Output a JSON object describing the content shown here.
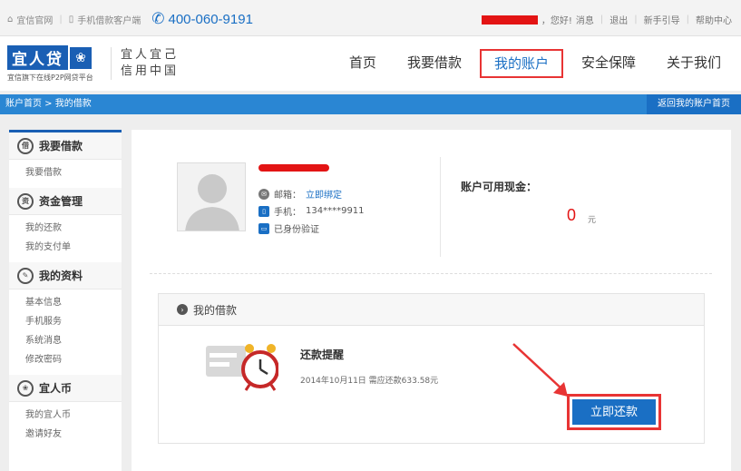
{
  "topbar": {
    "official_site": "宜信官网",
    "mobile_client": "手机借款客户端",
    "hotline": "400-060-9191",
    "greeting": "，您好!",
    "messages": "消息",
    "logout": "退出",
    "newbie_guide": "新手引导",
    "help_center": "帮助中心"
  },
  "logo": {
    "name": "宜人贷",
    "subtitle": "宜信旗下在线P2P网贷平台",
    "slogan_line1": "宜人宜己",
    "slogan_line2": "信用中国"
  },
  "nav": {
    "items": [
      "首页",
      "我要借款",
      "我的账户",
      "安全保障",
      "关于我们"
    ],
    "active": "我的账户"
  },
  "breadcrumb": {
    "path": "账户首页 > 我的借款",
    "back_label": "返回我的账户首页"
  },
  "sidebar": {
    "groups": [
      {
        "title": "我要借款",
        "icon": "borrow-icon",
        "items": [
          "我要借款"
        ]
      },
      {
        "title": "资金管理",
        "icon": "fund-icon",
        "items": [
          "我的还款",
          "我的支付单"
        ]
      },
      {
        "title": "我的资料",
        "icon": "profile-icon",
        "items": [
          "基本信息",
          "手机服务",
          "系统消息",
          "修改密码"
        ]
      },
      {
        "title": "宜人币",
        "icon": "coin-icon",
        "items": [
          "我的宜人币",
          "邀请好友"
        ]
      }
    ]
  },
  "account": {
    "email_label": "邮箱：",
    "email_action": "立即绑定",
    "phone_label": "手机：",
    "phone_value": "134****9911",
    "id_verified": "已身份验证",
    "cash_label": "账户可用现金：",
    "cash_value": "0",
    "cash_unit": "元"
  },
  "loans": {
    "header": "我的借款",
    "reminder_title": "还款提醒",
    "reminder_text": "2014年10月11日 需应还款633.58元",
    "pay_button": "立即还款"
  },
  "colors": {
    "brand_blue": "#1a6fc4",
    "highlight_red": "#e83434",
    "redaction_red": "#e31414"
  }
}
